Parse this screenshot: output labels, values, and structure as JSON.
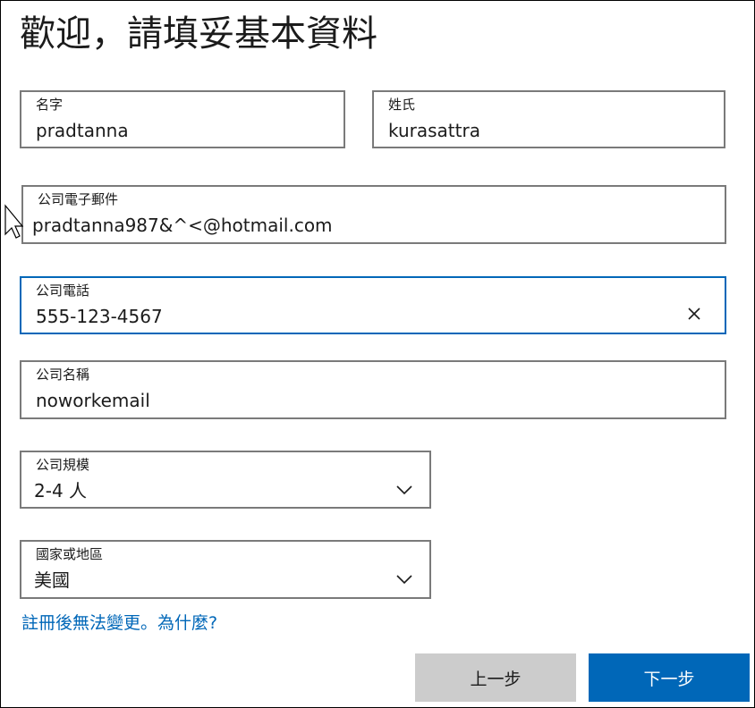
{
  "header": {
    "title": "歡迎，請填妥基本資料"
  },
  "form": {
    "first_name": {
      "label": "名字",
      "value": "pradtanna"
    },
    "last_name": {
      "label": "姓氏",
      "value": "kurasattra"
    },
    "work_email": {
      "label": "公司電子郵件",
      "value": "pradtanna987&^<@hotmail.com"
    },
    "work_phone": {
      "label": "公司電話",
      "value": "555-123-4567"
    },
    "company_name": {
      "label": "公司名稱",
      "value": "noworkemail"
    },
    "company_size": {
      "label": "公司規模",
      "value": "2-4 人"
    },
    "country": {
      "label": "國家或地區",
      "value": "美國"
    }
  },
  "help_link": {
    "text": "註冊後無法變更。為什麼?"
  },
  "buttons": {
    "back_label": "上一步",
    "next_label": "下一步"
  },
  "colors": {
    "accent": "#0067b8",
    "border": "#7a7a7a",
    "back_button": "#cccccc"
  },
  "icons": {
    "clear": "close-icon",
    "dropdown": "chevron-down-icon",
    "pointer": "mouse-cursor-icon"
  }
}
